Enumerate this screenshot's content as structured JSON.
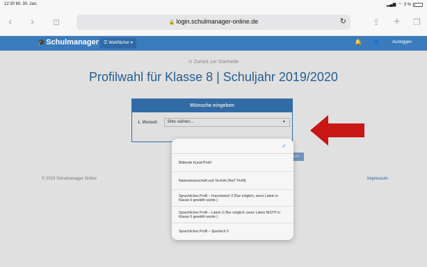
{
  "status_bar": {
    "time": "12:30  Mi. 30. Jan.",
    "battery": "3 %"
  },
  "browser": {
    "url": "login.schulmanager-online.de"
  },
  "header": {
    "logo": "Schulmanager",
    "nav_label": "Wahlfächer",
    "logout": "Ausloggen"
  },
  "page": {
    "back_link": "Zurück zur Startseite",
    "title": "Profilwahl für Klasse 8 | Schuljahr 2019/2020",
    "panel_title": "Wünsche eingeben",
    "wish_label": "1. Wunsch",
    "select_value": "Bitte wählen...",
    "save_peek": "ern",
    "footer_left": "© 2019 Schulmanager Online",
    "footer_right": "Impressum"
  },
  "picker": {
    "options": [
      "Bildende Kunst-Profil",
      "Naturwissenschaft und Technik (NwT Profil)",
      "Sprachliches Profil – Französisch 3 (Nur möglich, wenn Latein in Klasse 6 gewählt wurde.)",
      "Sprachliches Profil – Latein 3 (Nur möglich, wenn Latein NICHT in Klasse 6 gewählt wurde.)",
      "Sprachliches Profil – Spanisch 3"
    ]
  },
  "colors": {
    "brand": "#3a7bbd",
    "title": "#2c6aa6",
    "arrow": "#e41b17",
    "check": "#2a7ae2"
  }
}
